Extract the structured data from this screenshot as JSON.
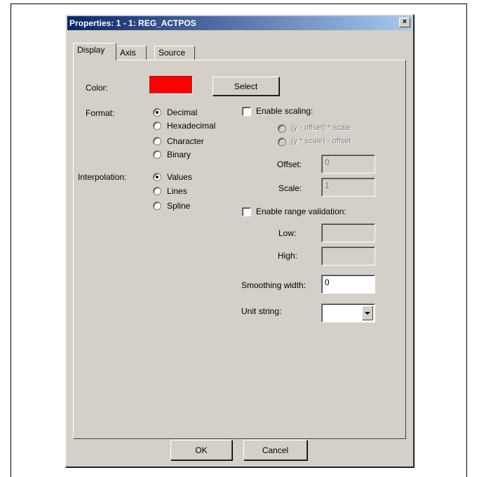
{
  "window": {
    "title": "Properties: 1 - 1: REG_ACTPOS",
    "close_glyph": "×"
  },
  "tabs": [
    {
      "label": "Display",
      "active": true
    },
    {
      "label": "Axis",
      "active": false
    },
    {
      "label": "Source",
      "active": false
    }
  ],
  "color": {
    "label": "Color:",
    "value": "#ff0000",
    "select_label": "Select"
  },
  "format": {
    "label": "Format:",
    "options": [
      "Decimal",
      "Hexadecimal",
      "Character",
      "Binary"
    ],
    "selected": "Decimal"
  },
  "interpolation": {
    "label": "Interpolation:",
    "options": [
      "Values",
      "Lines",
      "Spline"
    ],
    "selected": "Values"
  },
  "scaling": {
    "label": "Enable scaling:",
    "checked": false,
    "modes": [
      "(y - offset) * scale",
      "(y * scale) - offset"
    ],
    "offset_label": "Offset:",
    "offset_value": "0",
    "scale_label": "Scale:",
    "scale_value": "1"
  },
  "range": {
    "label": "Enable range validation:",
    "checked": false,
    "low_label": "Low:",
    "low_value": "",
    "high_label": "High:",
    "high_value": ""
  },
  "smoothing": {
    "label": "Smoothing width:",
    "value": "0"
  },
  "unit": {
    "label": "Unit string:",
    "value": ""
  },
  "buttons": {
    "ok": "OK",
    "cancel": "Cancel"
  }
}
